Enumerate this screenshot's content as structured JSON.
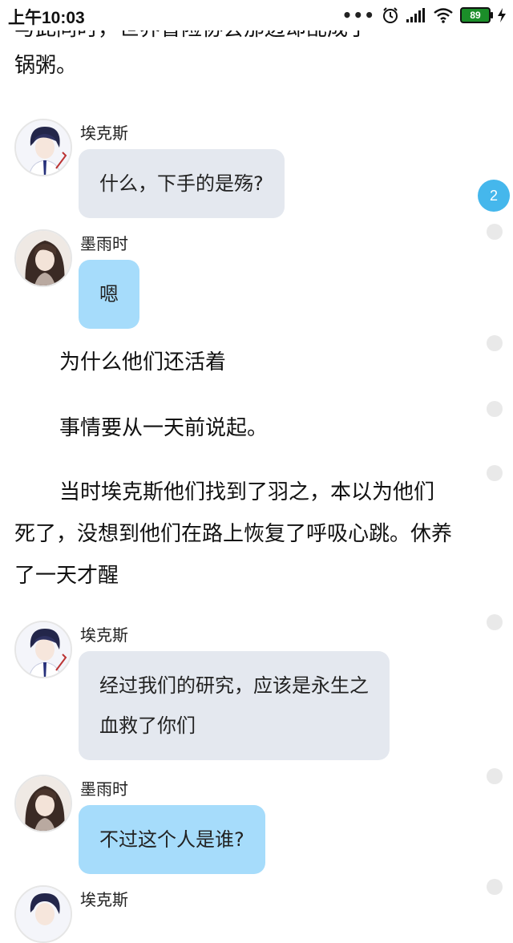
{
  "status_bar": {
    "time": "上午10:03",
    "dots": "•••",
    "battery": "89"
  },
  "story": {
    "clipped_line": "与此同时，世界冒险协会那边却乱成了一",
    "clipped_line_end": "锅粥。",
    "p1": "为什么他们还活着",
    "p2": "事情要从一天前说起。",
    "p3_line1": "当时埃克斯他们找到了羽之，本以为他们",
    "p3_line2": "死了，没想到他们在路上恢复了呼吸心跳。休养",
    "p3_line3": "了一天才醒"
  },
  "messages": [
    {
      "speaker": "埃克斯",
      "text": "什么，下手的是殇?"
    },
    {
      "speaker": "墨雨时",
      "text": "嗯"
    },
    {
      "speaker": "埃克斯",
      "line1": "经过我们的研究，应该是永生之",
      "line2": "血救了你们"
    },
    {
      "speaker": "墨雨时",
      "text": "不过这个人是谁?"
    },
    {
      "speaker": "埃克斯"
    }
  ],
  "side": {
    "badge_count": "2"
  },
  "colors": {
    "bubble_grey": "#e4e8ef",
    "bubble_blue": "#a6dcfb",
    "badge": "#45b7ec"
  }
}
